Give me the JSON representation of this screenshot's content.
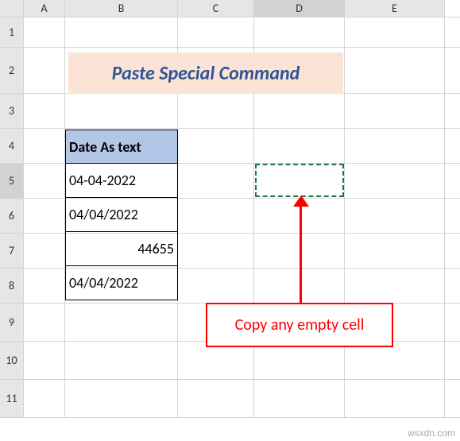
{
  "cols": {
    "A": "A",
    "B": "B",
    "C": "C",
    "D": "D",
    "E": "E"
  },
  "rows": {
    "r1": "1",
    "r2": "2",
    "r3": "3",
    "r4": "4",
    "r5": "5",
    "r6": "6",
    "r7": "7",
    "r8": "8",
    "r9": "9",
    "r10": "10",
    "r11": "11"
  },
  "title": "Paste Special Command",
  "table": {
    "header": "Date As text",
    "v1": "04-04-2022",
    "v2": "04/04/2022",
    "v3": "44655",
    "v4": "04/04/2022"
  },
  "callout": "Copy any empty cell",
  "watermark": "wsxdn.com",
  "chart_data": {
    "type": "table",
    "title": "Paste Special Command",
    "columns": [
      "Date As text"
    ],
    "rows": [
      [
        "04-04-2022"
      ],
      [
        "04/04/2022"
      ],
      [
        44655
      ],
      [
        "04/04/2022"
      ]
    ],
    "annotations": [
      "Copy any empty cell"
    ]
  }
}
